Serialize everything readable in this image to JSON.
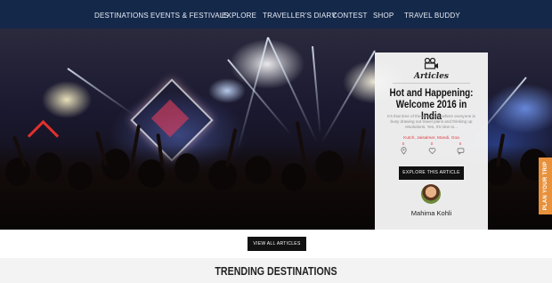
{
  "nav": {
    "items": [
      "DESTINATIONS",
      "EVENTS & FESTIVALS",
      "EXPLORE",
      "TRAVELLER'S DIARY",
      "CONTEST",
      "SHOP",
      "TRAVEL BUDDY"
    ]
  },
  "hero": {
    "card": {
      "category": "Articles",
      "category_icon": "film-camera-icon",
      "title": "Hot and Happening: Welcome 2016 in India",
      "excerpt": "It's that time of the year again where everyone is busy drawing out travel plans and thinking up resolutions. Yes, it's time to...",
      "tags": "Kutch, Jaisalmer, Mandi, Goa",
      "stats": [
        {
          "icon": "location-pin-icon",
          "count": "0"
        },
        {
          "icon": "heart-icon",
          "count": "0"
        },
        {
          "icon": "comment-icon",
          "count": "0"
        }
      ],
      "button": "EXPLORE THIS ARTICLE",
      "author": "Mahima Kohli"
    },
    "slider": {
      "total": 4,
      "active": 3
    },
    "side_tab": "PLAN YOUR TRIP"
  },
  "view_all": "VIEW ALL ARTICLES",
  "section_title": "TRENDING DESTINATIONS",
  "colors": {
    "nav_bg": "#14284a",
    "accent_orange": "#e8913a",
    "tag_red": "#e03b3b",
    "button_bg": "#111111"
  }
}
